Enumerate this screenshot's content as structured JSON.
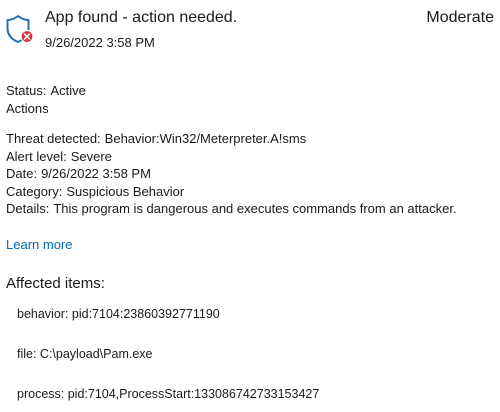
{
  "alert": {
    "icon": "shield-error-icon",
    "title": "App found - action needed.",
    "severity": "Moderate",
    "timestamp": "9/26/2022 3:58 PM"
  },
  "status": {
    "label": "Status:",
    "value": "Active",
    "actions_label": "Actions"
  },
  "details": {
    "threat_label": "Threat detected:",
    "threat_value": "Behavior:Win32/Meterpreter.A!sms",
    "alert_level_label": "Alert level:",
    "alert_level_value": "Severe",
    "date_label": "Date:",
    "date_value": "9/26/2022 3:58 PM",
    "category_label": "Category:",
    "category_value": "Suspicious Behavior",
    "details_label": "Details:",
    "details_value": "This program is dangerous and executes commands from an attacker."
  },
  "learn_more": "Learn more",
  "affected": {
    "heading": "Affected items:",
    "items": [
      "behavior: pid:7104:23860392771190",
      "file: C:\\payload\\Pam.exe",
      "process: pid:7104,ProcessStart:133086742733153427"
    ]
  },
  "colors": {
    "shield_blue": "#1f6fb2",
    "error_red": "#d13438",
    "link_blue": "#0067b8"
  }
}
